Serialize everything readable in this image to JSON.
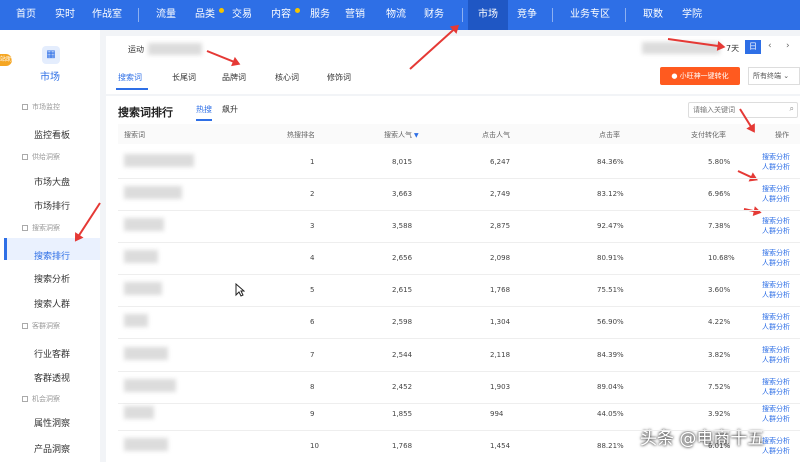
{
  "topnav": {
    "items": [
      {
        "label": "首页",
        "dot": false
      },
      {
        "label": "实时",
        "dot": false
      },
      {
        "label": "作战室",
        "dot": false
      },
      {
        "label": "流量",
        "dot": false
      },
      {
        "label": "品类",
        "dot": true
      },
      {
        "label": "交易",
        "dot": false
      },
      {
        "label": "内容",
        "dot": true
      },
      {
        "label": "服务",
        "dot": false
      },
      {
        "label": "营销",
        "dot": false
      },
      {
        "label": "物流",
        "dot": false
      },
      {
        "label": "财务",
        "dot": false
      },
      {
        "label": "市场",
        "dot": false
      },
      {
        "label": "竞争",
        "dot": false
      },
      {
        "label": "业务专区",
        "dot": false
      },
      {
        "label": "取数",
        "dot": false
      },
      {
        "label": "学院",
        "dot": false
      }
    ],
    "active": "市场",
    "bg_color": "#2e6fe6",
    "active_color": "#1f57c4"
  },
  "sidebar": {
    "logo_icon": "market-chart-icon",
    "title": "市场",
    "badge": "站助",
    "sections": [
      {
        "label": "市场监控",
        "items": [
          "监控看板"
        ]
      },
      {
        "label": "供给洞察",
        "items": [
          "市场大盘",
          "市场排行"
        ]
      },
      {
        "label": "搜索洞察",
        "items": [
          "搜索排行",
          "搜索分析",
          "搜索人群"
        ]
      },
      {
        "label": "客群洞察",
        "items": [
          "行业客群",
          "客群透视"
        ]
      },
      {
        "label": "机会洞察",
        "items": [
          "属性洞察",
          "产品洞察"
        ]
      }
    ],
    "active_item": "搜索排行"
  },
  "header": {
    "category_label": "运动",
    "period_label": "7天",
    "period_active": "日",
    "prev_icon": "chevron-left-icon",
    "next_icon": "chevron-right-icon",
    "tabs": [
      "搜索词",
      "长尾词",
      "品牌词",
      "核心词",
      "修饰词"
    ],
    "active_tab": "搜索词",
    "promo_label": "小旺神一键转化",
    "terminal_select": "所有终端"
  },
  "ranking": {
    "title": "搜索词排行",
    "subtabs": [
      "热搜",
      "飙升"
    ],
    "active_subtab": "热搜",
    "search_placeholder": "请输入关键词",
    "columns": [
      "搜索词",
      "热搜排名",
      "搜索人气",
      "点击人气",
      "点击率",
      "支付转化率",
      "操作"
    ],
    "sort_indicator": "▼",
    "action_1": "搜索分析",
    "action_2": "人群分析",
    "rows": [
      {
        "rank": "1",
        "search_pop": "8,015",
        "click_pop": "6,247",
        "ctr": "84.36%",
        "cvr": "5.80%"
      },
      {
        "rank": "2",
        "search_pop": "3,663",
        "click_pop": "2,749",
        "ctr": "83.12%",
        "cvr": "6.96%"
      },
      {
        "rank": "3",
        "search_pop": "3,588",
        "click_pop": "2,875",
        "ctr": "92.47%",
        "cvr": "7.38%"
      },
      {
        "rank": "4",
        "search_pop": "2,656",
        "click_pop": "2,098",
        "ctr": "80.91%",
        "cvr": "10.68%"
      },
      {
        "rank": "5",
        "search_pop": "2,615",
        "click_pop": "1,768",
        "ctr": "75.51%",
        "cvr": "3.60%"
      },
      {
        "rank": "6",
        "search_pop": "2,598",
        "click_pop": "1,304",
        "ctr": "56.90%",
        "cvr": "4.22%"
      },
      {
        "rank": "7",
        "search_pop": "2,544",
        "click_pop": "2,118",
        "ctr": "84.39%",
        "cvr": "3.82%"
      },
      {
        "rank": "8",
        "search_pop": "2,452",
        "click_pop": "1,903",
        "ctr": "89.04%",
        "cvr": "7.52%"
      },
      {
        "rank": "9",
        "search_pop": "1,855",
        "click_pop": "994",
        "ctr": "44.05%",
        "cvr": "3.92%"
      },
      {
        "rank": "10",
        "search_pop": "1,768",
        "click_pop": "1,454",
        "ctr": "88.21%",
        "cvr": "6.01%"
      }
    ]
  },
  "watermark": "头条 @电商十五",
  "annotation_color": "#e53935"
}
